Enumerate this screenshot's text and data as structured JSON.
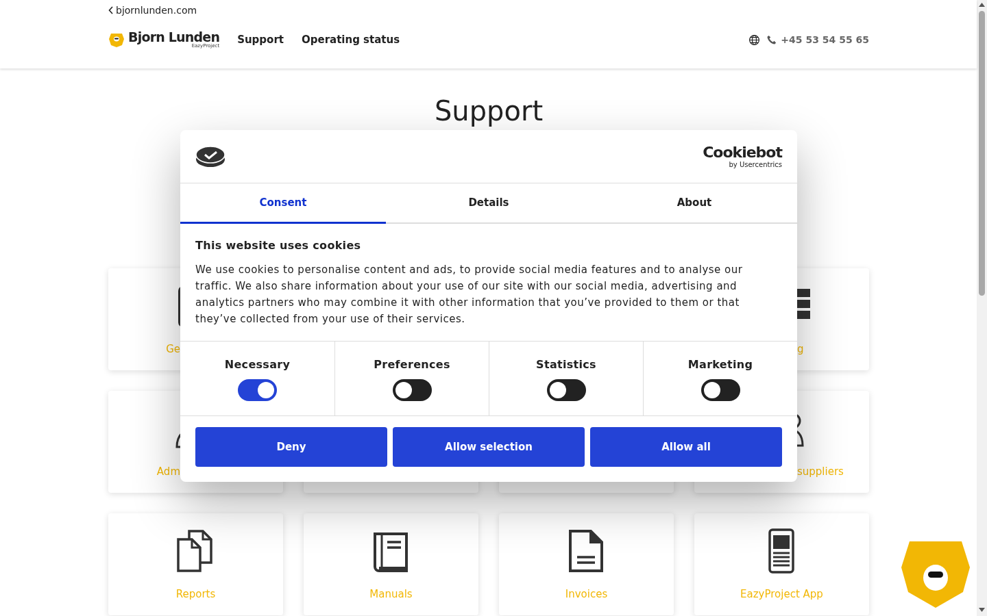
{
  "top_link": {
    "text": "bjornlunden.com"
  },
  "header": {
    "brand": "Bjorn Lunden",
    "brand_sub": "EazyProject",
    "nav": [
      {
        "label": "Support"
      },
      {
        "label": "Operating status"
      }
    ],
    "phone": "+45 53 54 55 65"
  },
  "page": {
    "title": "Support",
    "cards": [
      {
        "label": "Ge",
        "kind": "info"
      },
      {
        "label": "g",
        "kind": "blocks"
      },
      {
        "label": "Adm",
        "kind": "person"
      },
      {
        "kind": "covered"
      },
      {
        "kind": "covered"
      },
      {
        "label": "suppliers",
        "kind": "people"
      },
      {
        "label": "Reports",
        "kind": "docs"
      },
      {
        "label": "Manuals",
        "kind": "book"
      },
      {
        "label": "Invoices",
        "kind": "doc"
      },
      {
        "label": "EazyProject App",
        "kind": "phone"
      }
    ]
  },
  "cookie_dialog": {
    "brand": "Cookiebot",
    "brand_sub": "by Usercentrics",
    "tabs": [
      {
        "label": "Consent",
        "selected": true
      },
      {
        "label": "Details",
        "selected": false
      },
      {
        "label": "About",
        "selected": false
      }
    ],
    "heading": "This website uses cookies",
    "text": "We use cookies to personalise content and ads, to provide social media features and to analyse our traffic. We also share information about your use of our site with our social media, advertising and analytics partners who may combine it with other information that you’ve provided to them or that they’ve collected from your use of their services.",
    "categories": [
      {
        "label": "Necessary",
        "checked": true
      },
      {
        "label": "Preferences",
        "checked": false
      },
      {
        "label": "Statistics",
        "checked": false
      },
      {
        "label": "Marketing",
        "checked": false
      }
    ],
    "buttons": [
      {
        "label": "Deny"
      },
      {
        "label": "Allow selection"
      },
      {
        "label": "Allow all"
      }
    ]
  }
}
